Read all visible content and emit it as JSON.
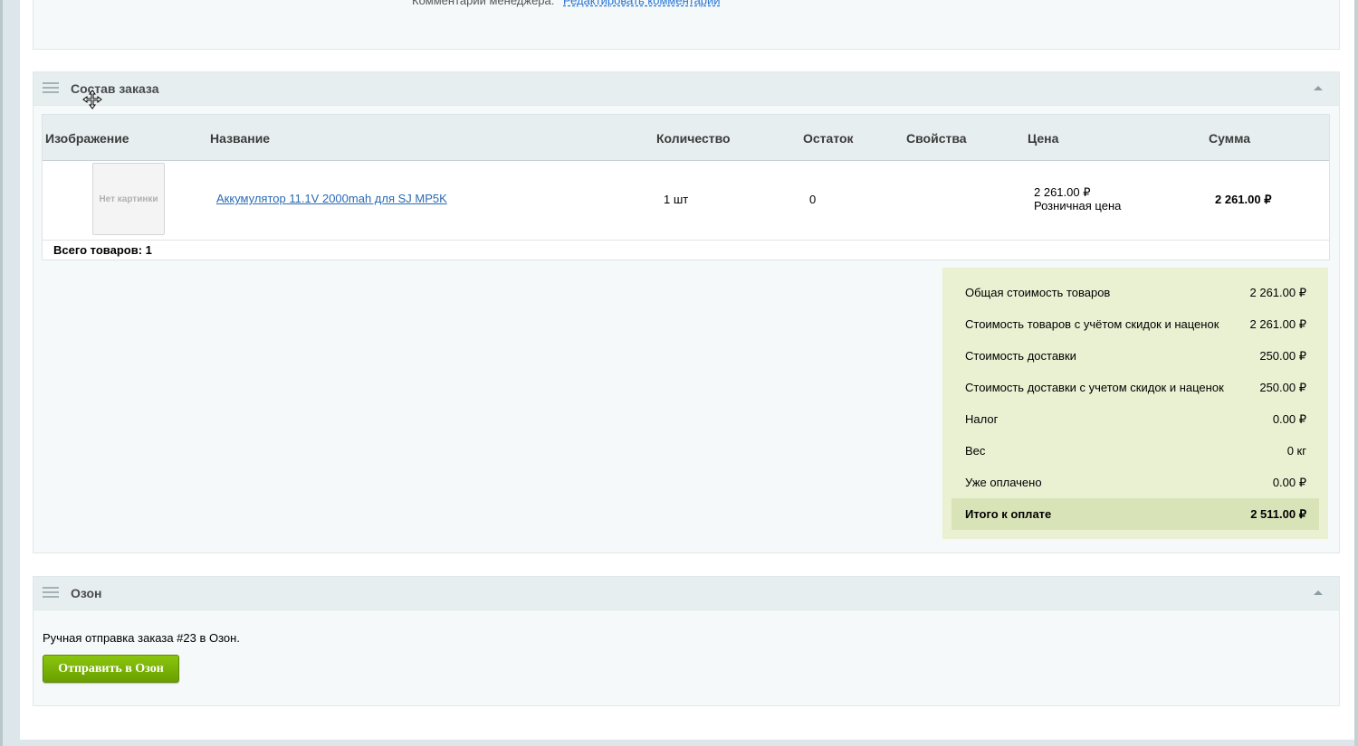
{
  "top_section": {
    "comment_label": "Комментарий менеджера:",
    "edit_link": "Редактировать комментарий"
  },
  "order_section": {
    "title": "Состав заказа",
    "columns": [
      "Изображение",
      "Название",
      "Количество",
      "Остаток",
      "Свойства",
      "Цена",
      "Сумма"
    ],
    "items": [
      {
        "image_text": "Нет картинки",
        "name": "Аккумулятор 11.1V 2000mah для SJ MP5K",
        "quantity": "1 шт",
        "stock": "0",
        "properties": "",
        "price": "2 261.00 ₽",
        "price_type": "Розничная цена",
        "sum": "2 261.00 ₽"
      }
    ],
    "total_items": "Всего товаров: 1"
  },
  "summary": [
    {
      "label": "Общая стоимость товаров",
      "value": "2 261.00 ₽"
    },
    {
      "label": "Стоимость товаров с учётом скидок и наценок",
      "value": "2 261.00 ₽"
    },
    {
      "label": "Стоимость доставки",
      "value": "250.00 ₽"
    },
    {
      "label": "Стоимость доставки с учетом скидок и наценок",
      "value": "250.00 ₽"
    },
    {
      "label": "Налог",
      "value": "0.00 ₽"
    },
    {
      "label": "Вес",
      "value": "0 кг"
    },
    {
      "label": "Уже оплачено",
      "value": "0.00 ₽"
    },
    {
      "label": "Итого к оплате",
      "value": "2 511.00 ₽"
    }
  ],
  "ozon_section": {
    "title": "Озон",
    "text": "Ручная отправка заказа #23 в Озон.",
    "button": "Отправить в Озон"
  },
  "colors": {
    "summary_bg": "#eaf0d2",
    "summary_total_bg": "#d9e3b8",
    "button_green": "#79b208",
    "link_blue": "#2a6ab3"
  }
}
